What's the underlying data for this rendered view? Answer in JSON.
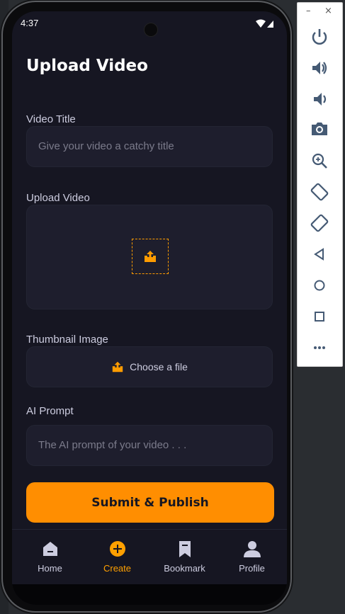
{
  "status_bar": {
    "time": "4:37"
  },
  "page": {
    "title": "Upload Video"
  },
  "form": {
    "video_title": {
      "label": "Video Title",
      "placeholder": "Give your video a catchy title"
    },
    "upload_video": {
      "label": "Upload Video"
    },
    "thumbnail": {
      "label": "Thumbnail Image",
      "button_label": "Choose a file"
    },
    "ai_prompt": {
      "label": "AI Prompt",
      "placeholder": "The AI prompt of your video . . ."
    },
    "submit_label": "Submit & Publish"
  },
  "tabs": [
    {
      "label": "Home",
      "icon": "home-icon"
    },
    {
      "label": "Create",
      "icon": "plus-circle-icon",
      "active": true
    },
    {
      "label": "Bookmark",
      "icon": "bookmark-icon"
    },
    {
      "label": "Profile",
      "icon": "profile-icon"
    }
  ],
  "emulator_panel": {
    "buttons": [
      "power-icon",
      "volume-up-icon",
      "volume-down-icon",
      "camera-icon",
      "zoom-icon",
      "rotate-left-icon",
      "rotate-right-icon",
      "back-icon",
      "home-circle-icon",
      "overview-icon",
      "more-icon"
    ]
  },
  "colors": {
    "background": "#161622",
    "field": "#1e1e2d",
    "accent": "#ff8e01",
    "active_tab": "#ffa001",
    "inactive_tab": "#cdcde0"
  }
}
